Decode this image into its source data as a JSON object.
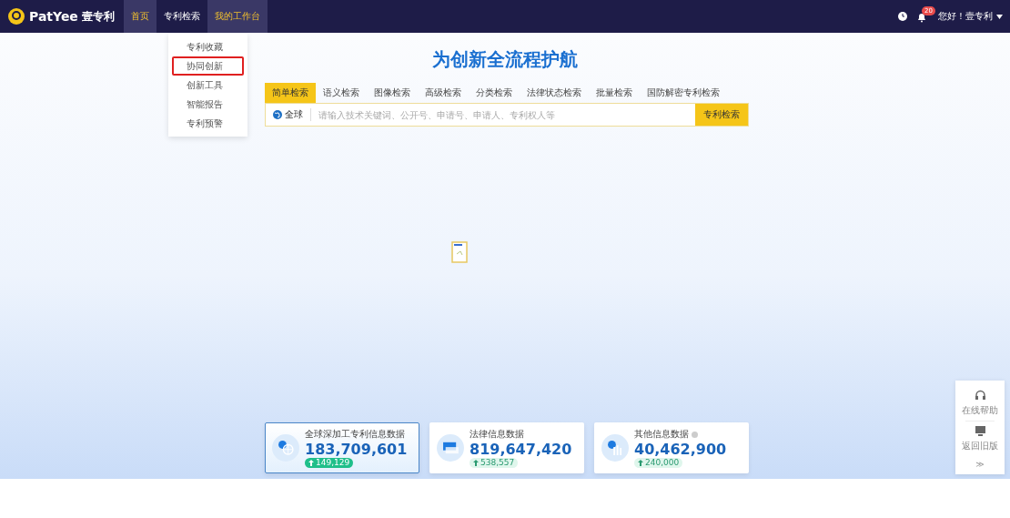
{
  "header": {
    "logo_text": "PatYee",
    "brand": "壹专利",
    "nav": [
      {
        "label": "首页",
        "selected": true
      },
      {
        "label": "专利检索",
        "selected": false
      },
      {
        "label": "我的工作台",
        "selected": true
      }
    ],
    "badge": "20",
    "greeting": "您好！壹专利"
  },
  "dropdown": {
    "items": [
      {
        "label": "专利收藏",
        "highlighted": false
      },
      {
        "label": "协同创新",
        "highlighted": true
      },
      {
        "label": "创新工具",
        "highlighted": false
      },
      {
        "label": "智能报告",
        "highlighted": false
      },
      {
        "label": "专利预警",
        "highlighted": false
      }
    ]
  },
  "hero": {
    "title": "为创新全流程护航"
  },
  "search": {
    "tabs": [
      {
        "label": "简单检索",
        "selected": true
      },
      {
        "label": "语义检索",
        "selected": false
      },
      {
        "label": "图像检索",
        "selected": false
      },
      {
        "label": "高级检索",
        "selected": false
      },
      {
        "label": "分类检索",
        "selected": false
      },
      {
        "label": "法律状态检索",
        "selected": false
      },
      {
        "label": "批量检索",
        "selected": false
      },
      {
        "label": "国防解密专利检索",
        "selected": false
      }
    ],
    "scope": "全球",
    "placeholder": "请输入技术关键词、公开号、申请号、申请人、专利权人等",
    "button": "专利检索"
  },
  "stats": [
    {
      "kind": "globe",
      "label": "全球深加工专利信息数据",
      "value": "183,709,601",
      "delta": "149,129",
      "selected": true,
      "info": false
    },
    {
      "kind": "screen",
      "label": "法律信息数据",
      "value": "819,647,420",
      "delta": "538,557",
      "selected": false,
      "info": false
    },
    {
      "kind": "bars",
      "label": "其他信息数据",
      "value": "40,462,900",
      "delta": "240,000",
      "selected": false,
      "info": true
    }
  ],
  "side_widget": {
    "items": [
      {
        "kind": "headset",
        "label": "在线帮助"
      },
      {
        "kind": "monitor",
        "label": "返回旧版"
      }
    ],
    "collapse": "≫"
  }
}
